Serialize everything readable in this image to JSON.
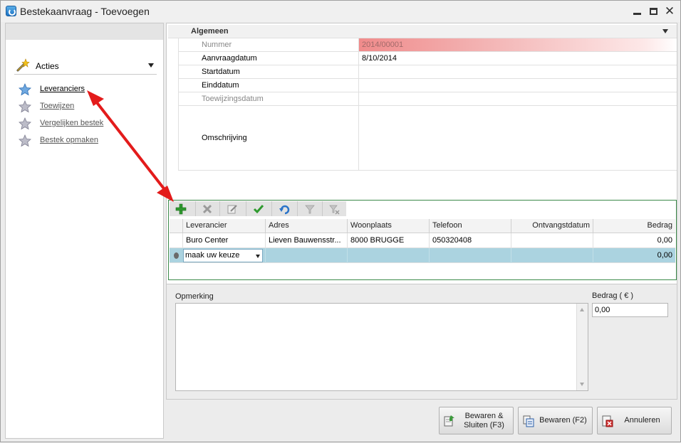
{
  "window": {
    "title": "Bestekaanvraag - Toevoegen",
    "controls": {
      "minimize": "minimize",
      "maximize": "maximize",
      "close": "✕"
    }
  },
  "sidebar": {
    "header": "Acties",
    "items": [
      {
        "label": "Leveranciers",
        "enabled": true
      },
      {
        "label": "Toewijzen",
        "enabled": false
      },
      {
        "label": "Vergelijken bestek",
        "enabled": false
      },
      {
        "label": "Bestek opmaken",
        "enabled": false
      }
    ]
  },
  "general": {
    "category": "Algemeen",
    "rows": [
      {
        "label": "Nummer",
        "value": "2014/00001",
        "readonly": true
      },
      {
        "label": "Aanvraagdatum",
        "value": "8/10/2014",
        "readonly": false
      },
      {
        "label": "Startdatum",
        "value": "",
        "readonly": false
      },
      {
        "label": "Einddatum",
        "value": "",
        "readonly": false
      },
      {
        "label": "Toewijzingsdatum",
        "value": "",
        "readonly": true
      },
      {
        "label": "Omschrijving",
        "value": "",
        "readonly": false
      }
    ]
  },
  "suppliers": {
    "toolbar": [
      "add-icon",
      "delete-icon",
      "edit-icon",
      "confirm-icon",
      "undo-icon",
      "filter-icon",
      "filter-clear-icon"
    ],
    "columns": [
      "Leverancier",
      "Adres",
      "Woonplaats",
      "Telefoon",
      "Ontvangstdatum",
      "Bedrag"
    ],
    "rows": [
      {
        "leverancier": "Buro Center",
        "adres": "Lieven Bauwensstr...",
        "woonplaats": "8000 BRUGGE",
        "telefoon": "050320408",
        "ontvangstdatum": "",
        "bedrag": "0,00"
      }
    ],
    "editing_row": {
      "combo_value": "maak uw keuze",
      "bedrag": "0,00"
    }
  },
  "remark": {
    "label": "Opmerking",
    "value": "",
    "amount_label": "Bedrag ( € )",
    "amount_value": "0,00"
  },
  "buttons": {
    "save_close": "Bewaren & Sluiten (F3)",
    "save": "Bewaren (F2)",
    "cancel": "Annuleren"
  },
  "colors": {
    "annotation_arrow": "#e31b1b",
    "supplier_border": "#3c8a4a",
    "editing_row": "#abd3e0"
  }
}
